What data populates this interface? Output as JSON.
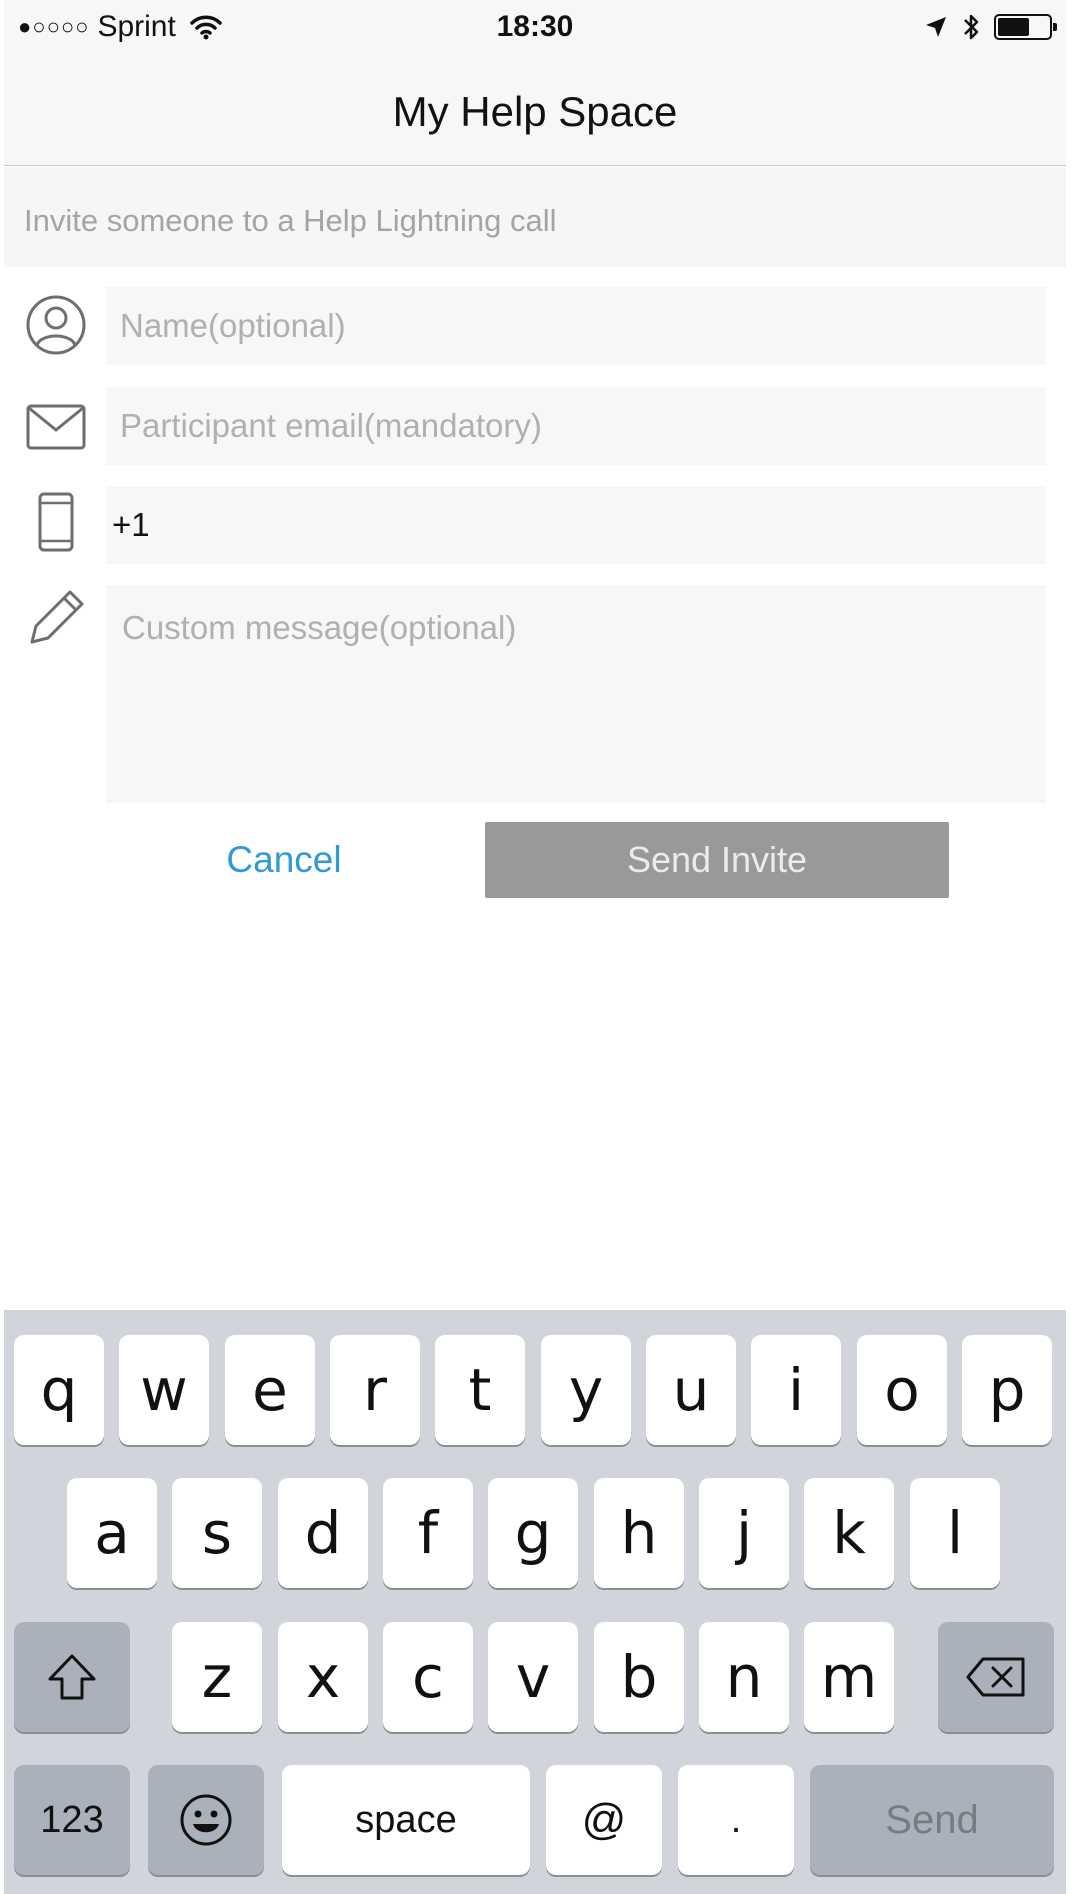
{
  "status_bar": {
    "signal": "●○○○○",
    "carrier": "Sprint",
    "time": "18:30"
  },
  "nav": {
    "title": "My Help Space"
  },
  "subtitle": "Invite someone to a Help Lightning call",
  "form": {
    "name_placeholder": "Name(optional)",
    "email_placeholder": "Participant email(mandatory)",
    "phone_value": "+1",
    "message_placeholder": "Custom message(optional)"
  },
  "actions": {
    "cancel": "Cancel",
    "send": "Send Invite"
  },
  "keyboard": {
    "row1": [
      "q",
      "w",
      "e",
      "r",
      "t",
      "y",
      "u",
      "i",
      "o",
      "p"
    ],
    "row2": [
      "a",
      "s",
      "d",
      "f",
      "g",
      "h",
      "j",
      "k",
      "l"
    ],
    "row3": [
      "z",
      "x",
      "c",
      "v",
      "b",
      "n",
      "m"
    ],
    "numbers": "123",
    "space": "space",
    "at": "@",
    "dot": ".",
    "send": "Send"
  },
  "colors": {
    "accent": "#2e9bd6",
    "disabled_button": "#999999",
    "keyboard_bg": "#d1d5db"
  }
}
